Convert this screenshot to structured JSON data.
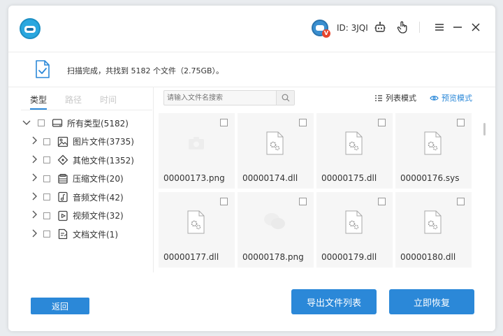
{
  "header": {
    "user_id": "ID: 3JQI",
    "avatar_badge": "V",
    "icons": [
      "app-logo-icon",
      "robot-icon",
      "hand-pointer-icon",
      "menu-icon",
      "minimize-icon",
      "close-icon"
    ]
  },
  "status": {
    "text": "扫描完成，共找到 5182 个文件（2.75GB）。"
  },
  "tabs": [
    {
      "label": "类型",
      "active": true
    },
    {
      "label": "路径",
      "active": false
    },
    {
      "label": "时间",
      "active": false
    }
  ],
  "tree": {
    "root": {
      "label": "所有类型(5182)"
    },
    "items": [
      {
        "label": "图片文件(3735)",
        "icon": "image-icon"
      },
      {
        "label": "其他文件(1352)",
        "icon": "other-file-icon"
      },
      {
        "label": "压缩文件(20)",
        "icon": "archive-icon"
      },
      {
        "label": "音频文件(42)",
        "icon": "audio-icon"
      },
      {
        "label": "视频文件(32)",
        "icon": "video-icon"
      },
      {
        "label": "文档文件(1)",
        "icon": "document-icon"
      }
    ]
  },
  "search": {
    "placeholder": "请输入文件名搜索"
  },
  "view": {
    "list_label": "列表模式",
    "preview_label": "预览模式"
  },
  "files": [
    {
      "name": "00000173.png"
    },
    {
      "name": "00000174.dll"
    },
    {
      "name": "00000175.dll"
    },
    {
      "name": "00000176.sys"
    },
    {
      "name": "00000177.dll"
    },
    {
      "name": "00000178.png"
    },
    {
      "name": "00000179.dll"
    },
    {
      "name": "00000180.dll"
    }
  ],
  "footer": {
    "back_label": "返回",
    "export_label": "导出文件列表",
    "recover_label": "立即恢复"
  },
  "colors": {
    "accent": "#2b88d8",
    "card_bg": "#f6f6f6"
  }
}
